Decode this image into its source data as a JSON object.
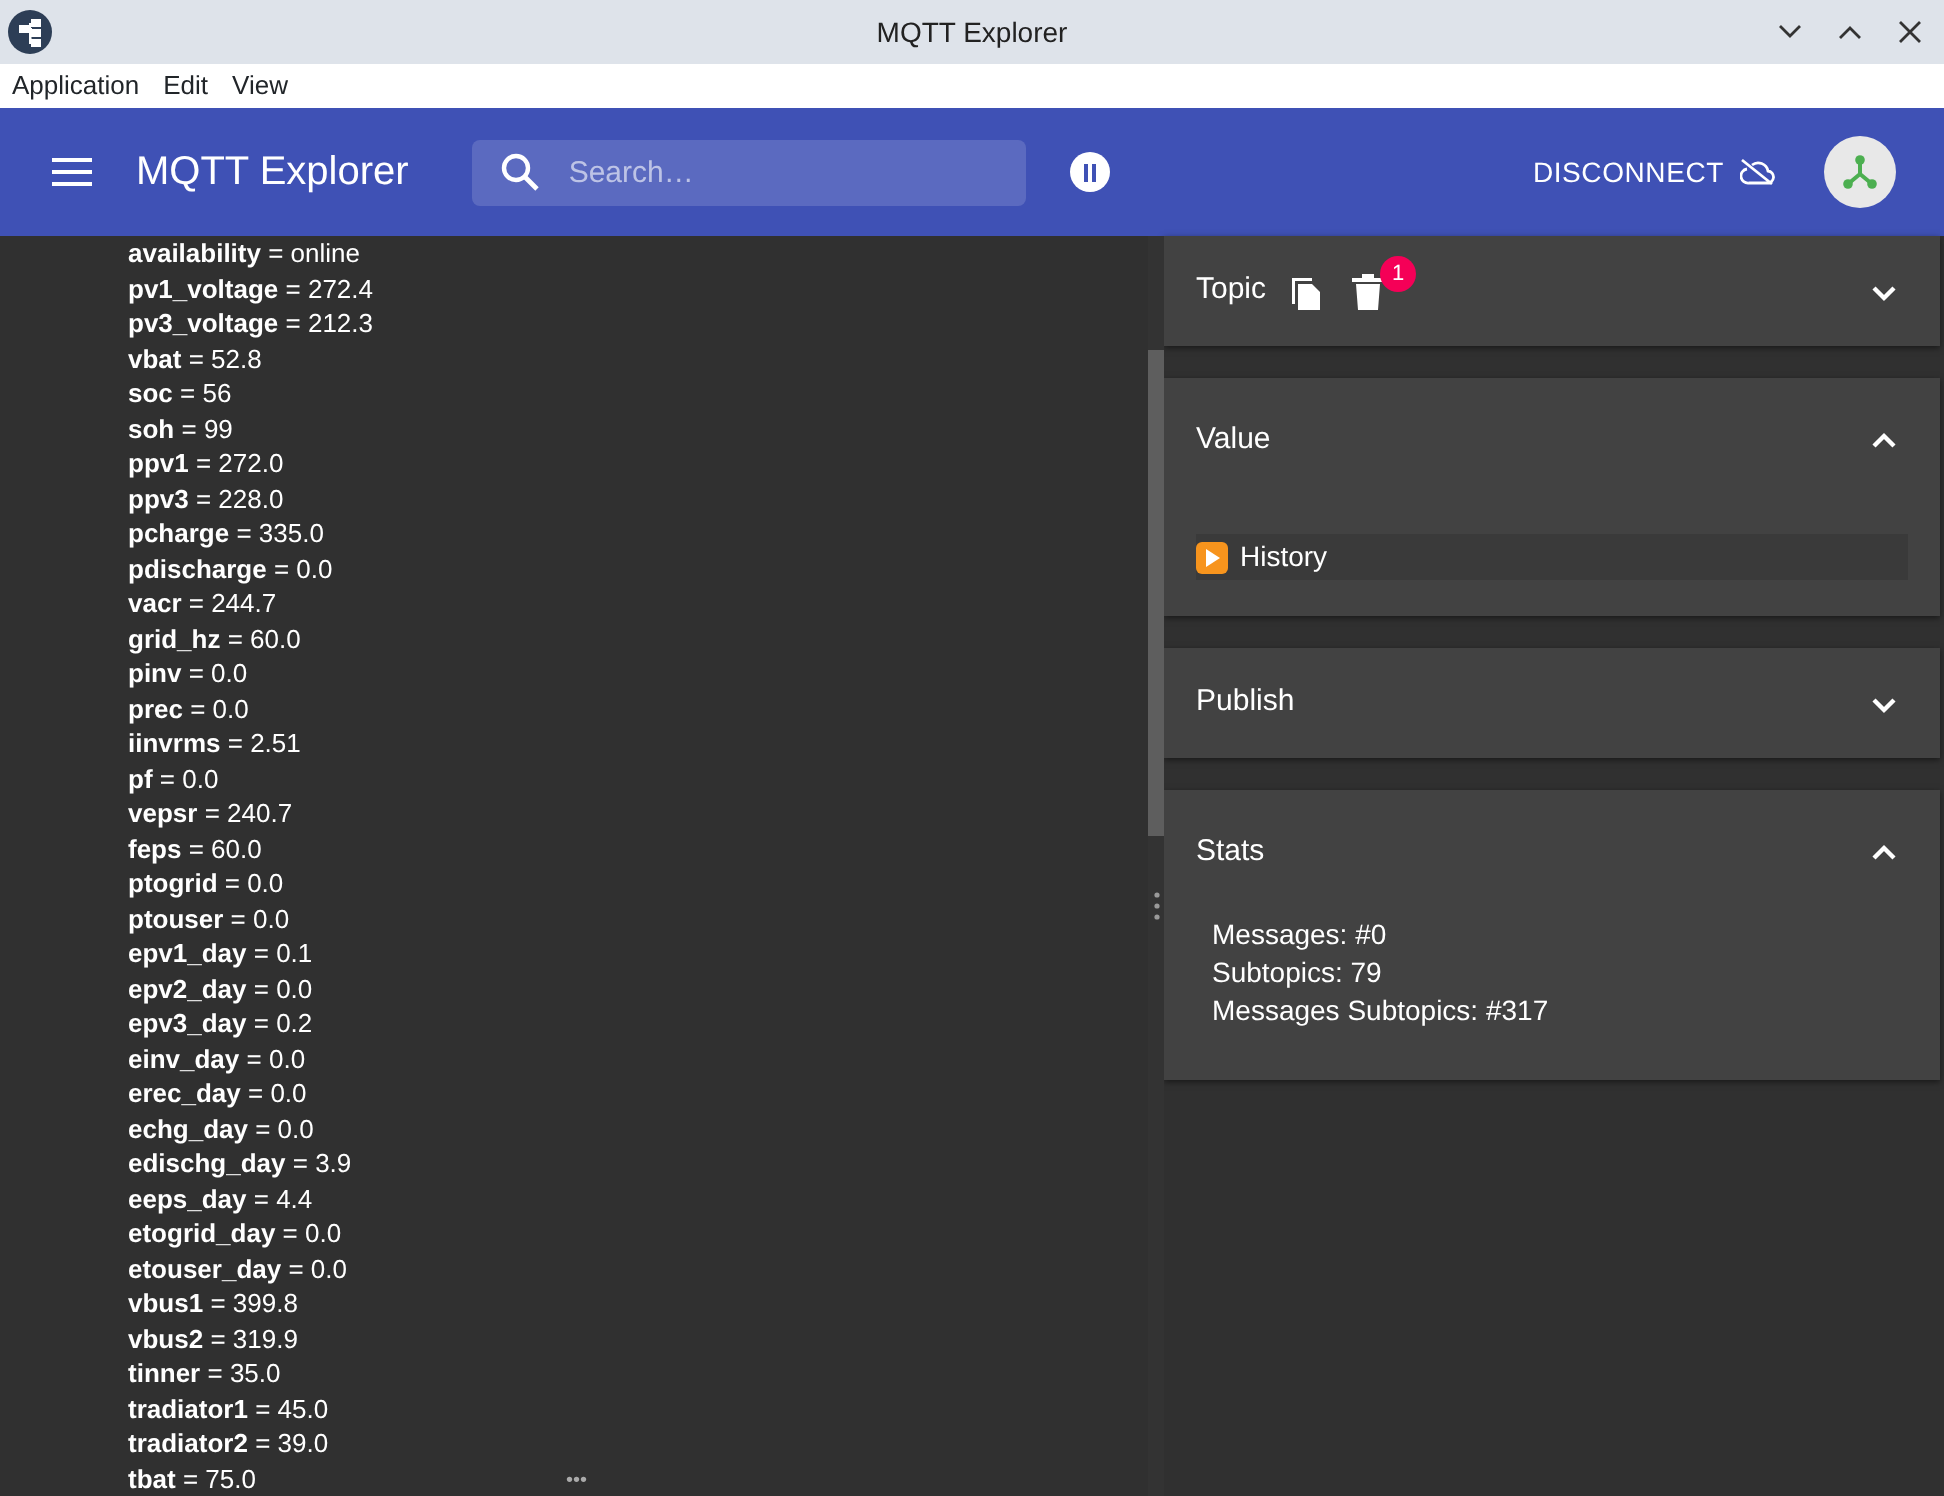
{
  "window": {
    "title": "MQTT Explorer"
  },
  "menu": [
    "Application",
    "Edit",
    "View"
  ],
  "app_bar": {
    "title": "MQTT Explorer",
    "search": {
      "placeholder": "Search…"
    },
    "disconnect": "DISCONNECT"
  },
  "tree": {
    "rows": [
      {
        "text": "**availability** = online"
      },
      {
        "text": "**pv1_voltage** = 272.4"
      },
      {
        "text": "**pv3_voltage** = 212.3"
      },
      {
        "text": "**vbat** = 52.8"
      },
      {
        "text": "**soc** = 56"
      },
      {
        "text": "**soh** = 99"
      },
      {
        "text": "**ppv1** = 272.0"
      },
      {
        "text": "**ppv3** = 228.0"
      },
      {
        "text": "**pcharge** = 335.0"
      },
      {
        "text": "**pdischarge** = 0.0"
      },
      {
        "text": "**vacr** = 244.7"
      },
      {
        "text": "**grid_hz** = 60.0"
      },
      {
        "text": "**pinv** = 0.0"
      },
      {
        "text": "**prec** = 0.0"
      },
      {
        "text": "**iinvrms** = 2.51"
      },
      {
        "text": "**pf** = 0.0"
      },
      {
        "text": "**vepsr** = 240.7"
      },
      {
        "text": "**feps** = 60.0"
      },
      {
        "text": "**ptogrid** = 0.0"
      },
      {
        "text": "**ptouser** = 0.0"
      },
      {
        "text": "**epv1_day** = 0.1"
      },
      {
        "text": "**epv2_day** = 0.0"
      },
      {
        "text": "**epv3_day** = 0.2"
      },
      {
        "text": "**einv_day** = 0.0"
      },
      {
        "text": "**erec_day** = 0.0"
      },
      {
        "text": "**echg_day** = 0.0"
      },
      {
        "text": "**edischg_day** = 3.9"
      },
      {
        "text": "**eeps_day** = 4.4"
      },
      {
        "text": "**etogrid_day** = 0.0"
      },
      {
        "text": "**etouser_day** = 0.0"
      },
      {
        "text": "**vbus1** = 399.8"
      },
      {
        "text": "**vbus2** = 319.9"
      },
      {
        "text": "**tinner** = 35.0"
      },
      {
        "text": "**tradiator1** = 45.0"
      },
      {
        "text": "**tradiator2** = 39.0"
      },
      {
        "text": "**tbat** = 75.0"
      }
    ],
    "more": "•••"
  },
  "panels": [
    {
      "kind": "topic",
      "title": "Topic",
      "expanded": false,
      "badge": "1"
    },
    {
      "kind": "value",
      "title": "Value",
      "expanded": true,
      "history": "History"
    },
    {
      "kind": "plain",
      "title": "Publish",
      "expanded": false
    },
    {
      "kind": "stats",
      "title": "Stats",
      "expanded": true,
      "lines": [
        "Messages: #0",
        "Subtopics: 79",
        "Messages Subtopics: #317"
      ]
    }
  ]
}
